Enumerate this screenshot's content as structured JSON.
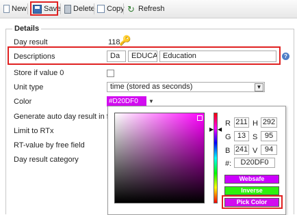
{
  "toolbar": {
    "new_label": "New",
    "save_label": "Save",
    "delete_label": "Delete",
    "copy_label": "Copy",
    "refresh_label": "Refresh"
  },
  "details": {
    "legend": "Details",
    "day_result_label": "Day result",
    "day_result_value": "118",
    "descriptions_label": "Descriptions",
    "desc_lang": "Da",
    "desc_code": "EDUCAT",
    "desc_text": "Education",
    "help_icon": "?",
    "store_if_zero_label": "Store if value 0",
    "unit_type_label": "Unit type",
    "unit_type_value": "time (stored as seconds)",
    "color_label": "Color",
    "color_value": "#D20DF0",
    "color_swatch": "#d20df0",
    "generate_label": "Generate auto day result in future",
    "limit_label": "Limit to RTx",
    "rt_value_label": "RT-value by free field",
    "category_label": "Day result category"
  },
  "picker": {
    "r_label": "R",
    "r_value": "211",
    "g_label": "G",
    "g_value": "13",
    "b_label": "B",
    "b_value": "241",
    "h_label": "H",
    "h_value": "292",
    "s_label": "S",
    "s_value": "95",
    "v_label": "V",
    "v_value": "94",
    "hex_label": "#:",
    "hex_value": "D20DF0",
    "websafe_label": "Websafe",
    "inverse_label": "Inverse",
    "pick_label": "Pick Color",
    "websafe_color": "#cc00ff",
    "inverse_color": "#2df20f",
    "pick_color": "#d20df0"
  }
}
